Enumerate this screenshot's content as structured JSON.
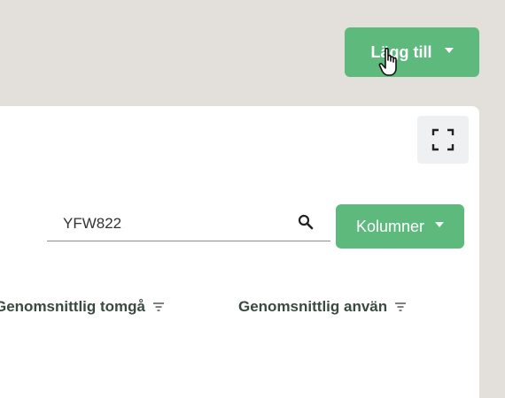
{
  "header": {
    "add_button_label": "Lägg till"
  },
  "search": {
    "value": "YFW822"
  },
  "toolbar": {
    "columns_label": "Kolumner"
  },
  "table": {
    "columns": [
      {
        "label": "Genomsnittlig tomgå"
      },
      {
        "label": "Genomsnittlig använ"
      }
    ]
  },
  "colors": {
    "accent": "#5dba7c",
    "background": "#e3e0dc"
  }
}
